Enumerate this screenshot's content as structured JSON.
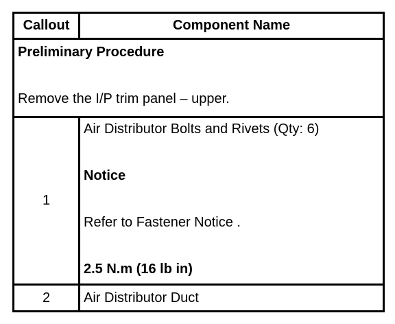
{
  "header": {
    "callout": "Callout",
    "component_name": "Component Name"
  },
  "preliminary": {
    "title": "Preliminary Procedure",
    "text": "Remove the I/P trim panel – upper."
  },
  "steps": [
    {
      "callout": "1",
      "name": "Air Distributor Bolts and Rivets (Qty: 6)",
      "notice_label": "Notice",
      "notice_text": "Refer to Fastener Notice .",
      "torque": "2.5 N.m (16 lb in)"
    },
    {
      "callout": "2",
      "name": "Air Distributor Duct"
    }
  ]
}
